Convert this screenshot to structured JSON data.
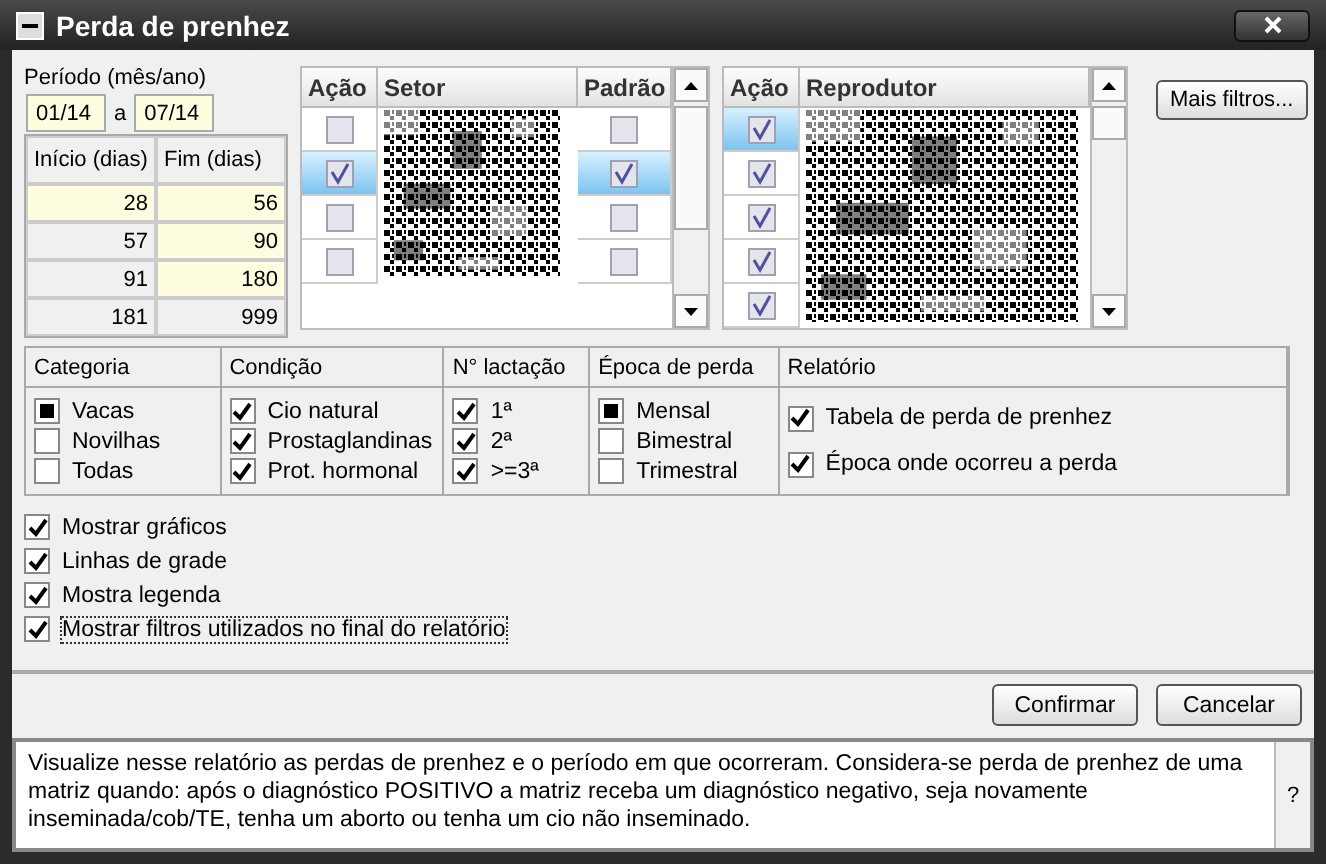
{
  "window": {
    "title": "Perda de prenhez"
  },
  "period": {
    "label": "Período (mês/ano)",
    "start": "01/14",
    "separator": "a",
    "end": "07/14"
  },
  "ranges": {
    "columns": [
      "Início (dias)",
      "Fim (dias)"
    ],
    "rows": [
      [
        {
          "text": "28",
          "highlighted": true
        },
        {
          "text": "56",
          "highlighted": true
        }
      ],
      [
        {
          "text": "57",
          "highlighted": false
        },
        {
          "text": "90",
          "highlighted": true
        }
      ],
      [
        {
          "text": "91",
          "highlighted": false
        },
        {
          "text": "180",
          "highlighted": true
        }
      ],
      [
        {
          "text": "181",
          "highlighted": false
        },
        {
          "text": "999",
          "highlighted": false
        }
      ]
    ]
  },
  "sector_table": {
    "columns": [
      "Ação",
      "Setor",
      "Padrão"
    ],
    "rows": [
      {
        "selected": false,
        "action": false,
        "default": false
      },
      {
        "selected": true,
        "action": true,
        "default": true
      },
      {
        "selected": false,
        "action": false,
        "default": false
      },
      {
        "selected": false,
        "action": false,
        "default": false
      }
    ]
  },
  "sire_table": {
    "columns": [
      "Ação",
      "Reprodutor"
    ],
    "rows": [
      {
        "selected": true,
        "action": true
      },
      {
        "selected": false,
        "action": true
      },
      {
        "selected": false,
        "action": true
      },
      {
        "selected": false,
        "action": true
      },
      {
        "selected": false,
        "action": true
      }
    ]
  },
  "more_filters_button": "Mais filtros...",
  "filter_groups": [
    {
      "title": "Categoria",
      "kind": "radio",
      "options": [
        {
          "label": "Vacas",
          "checked": true
        },
        {
          "label": "Novilhas",
          "checked": false
        },
        {
          "label": "Todas",
          "checked": false
        }
      ]
    },
    {
      "title": "Condição",
      "kind": "check",
      "options": [
        {
          "label": "Cio natural",
          "checked": true
        },
        {
          "label": "Prostaglandinas",
          "checked": true
        },
        {
          "label": "Prot. hormonal",
          "checked": true
        }
      ]
    },
    {
      "title": "N° lactação",
      "kind": "check",
      "options": [
        {
          "label": "1ª",
          "checked": true
        },
        {
          "label": "2ª",
          "checked": true
        },
        {
          "label": ">=3ª",
          "checked": true
        }
      ]
    },
    {
      "title": "Época de perda",
      "kind": "radio",
      "options": [
        {
          "label": "Mensal",
          "checked": true
        },
        {
          "label": "Bimestral",
          "checked": false
        },
        {
          "label": "Trimestral",
          "checked": false
        }
      ]
    },
    {
      "title": "Relatório",
      "kind": "check",
      "options": [
        {
          "label": "Tabela de perda de prenhez",
          "checked": true
        },
        {
          "label": "Época onde ocorreu a perda",
          "checked": true
        }
      ]
    }
  ],
  "options": [
    {
      "label": "Mostrar gráficos",
      "checked": true,
      "focused": false
    },
    {
      "label": "Linhas de grade",
      "checked": true,
      "focused": false
    },
    {
      "label": "Mostra legenda",
      "checked": true,
      "focused": false
    },
    {
      "label": "Mostrar filtros utilizados no final do relatório",
      "checked": true,
      "focused": true
    }
  ],
  "buttons": [
    "Confirmar",
    "Cancelar"
  ],
  "help": {
    "text": "Visualize nesse relatório as perdas de prenhez e o período em que ocorreram. Considera-se perda de prenhez de uma matriz quando: após o diagnóstico POSITIVO a matriz receba um diagnóstico negativo, seja novamente inseminada/cob/TE, tenha um aborto ou tenha um cio não inseminado.",
    "button": "?"
  }
}
